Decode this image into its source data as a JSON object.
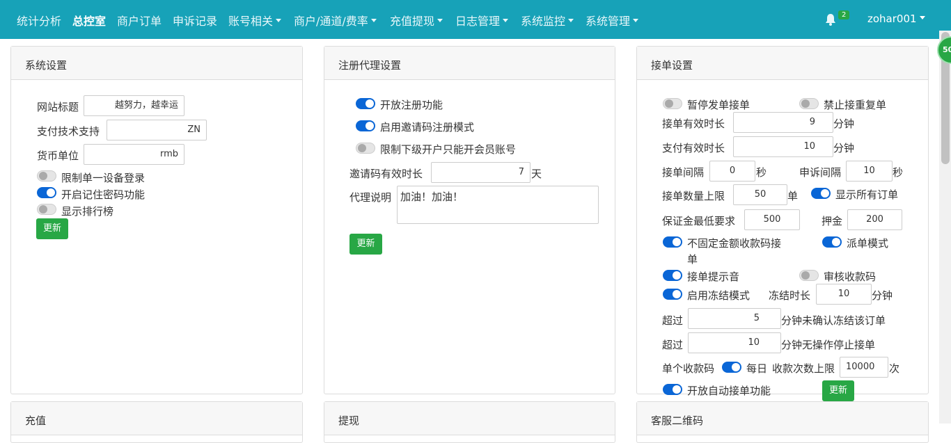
{
  "nav": {
    "items": [
      "统计分析",
      "总控室",
      "商户订单",
      "申诉记录",
      "账号相关",
      "商户/通道/费率",
      "充值提现",
      "日志管理",
      "系统监控",
      "系统管理"
    ],
    "badge": "2",
    "user": "zohar001",
    "float": "50"
  },
  "system": {
    "title": "系统设置",
    "site_title_label": "网站标题",
    "site_title_value": "越努力，越幸运",
    "tech_label": "支付技术支持",
    "tech_value": "ZN",
    "currency_label": "货币单位",
    "currency_value": "rmb",
    "single_device": "限制单一设备登录",
    "remember_pwd": "开启记住密码功能",
    "ranking": "显示排行榜",
    "update": "更新"
  },
  "agent": {
    "title": "注册代理设置",
    "open_reg": "开放注册功能",
    "invite_mode": "启用邀请码注册模式",
    "restrict": "限制下级开户只能开会员账号",
    "invite_valid_label": "邀请码有效时长",
    "invite_valid_value": "7",
    "day": "天",
    "desc_label": "代理说明",
    "desc_value": "加油！加油！",
    "update": "更新"
  },
  "order": {
    "title": "接单设置",
    "pause": "暂停发单接单",
    "no_repeat": "禁止接重复单",
    "valid_label": "接单有效时长",
    "valid_value": "9",
    "minute": "分钟",
    "pay_valid_label": "支付有效时长",
    "pay_valid_value": "10",
    "interval_label": "接单间隔",
    "interval_value": "0",
    "sec": "秒",
    "appeal_label": "申诉间隔",
    "appeal_value": "10",
    "max_label": "接单数量上限",
    "max_value": "50",
    "dan": "单",
    "show_all": "显示所有订单",
    "deposit_min_label": "保证金最低要求",
    "deposit_min_value": "500",
    "deposit_label": "押金",
    "deposit_value": "200",
    "non_fixed_1": "不固定金额收款码接",
    "non_fixed_2": "单",
    "dispatch": "派单模式",
    "sound": "接单提示音",
    "review_code": "审核收款码",
    "freeze_mode": "启用冻结模式",
    "freeze_dur_label": "冻结时长",
    "freeze_dur_value": "10",
    "over": "超过",
    "unconfirm_value": "5",
    "unconfirm_suffix": "分钟未确认冻结该订单",
    "noop_value": "10",
    "noop_suffix": "分钟无操作停止接单",
    "single_code": "单个收款码",
    "daily": "每日",
    "recv_limit_label": "收款次数上限",
    "recv_limit_value": "10000",
    "times": "次",
    "auto_accept": "开放自动接单功能",
    "update": "更新"
  },
  "bottom": {
    "recharge": "充值",
    "withdraw": "提现",
    "service_qr": "客服二维码"
  }
}
